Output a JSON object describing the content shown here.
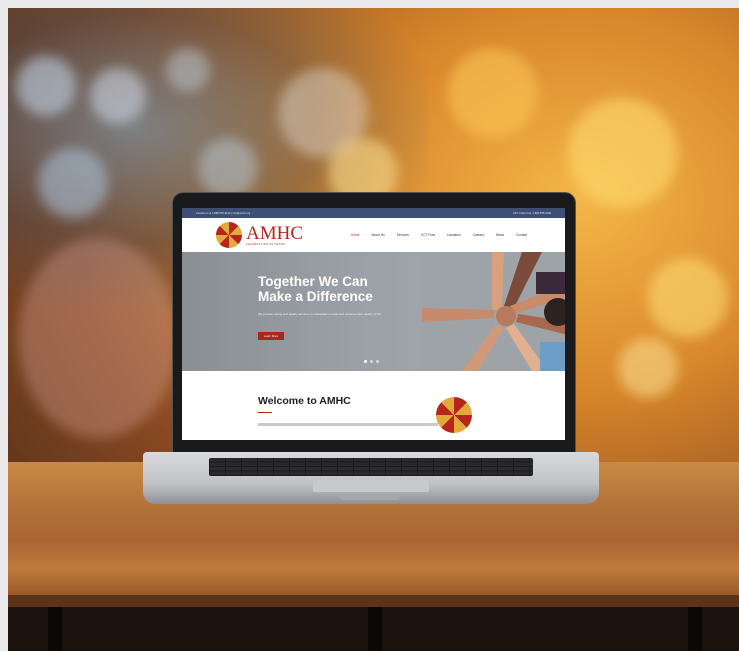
{
  "colors": {
    "brand_red": "#b7251c",
    "brand_gold": "#e3a93b",
    "topbar_navy": "#3d4f73"
  },
  "website": {
    "topbar": {
      "left_text": "Contact us at 1-888-555-0123 | info@amhc.org",
      "right_text": "24/7 Crisis Line: 1-800-555-0199"
    },
    "logo": {
      "title": "AMHC",
      "tagline": "CELEBRATING 50 YEARS"
    },
    "menu": [
      {
        "label": "Home",
        "active": true
      },
      {
        "label": "About Us",
        "active": false
      },
      {
        "label": "Services",
        "active": false
      },
      {
        "label": "CCT Flow",
        "active": false
      },
      {
        "label": "Locations",
        "active": false
      },
      {
        "label": "Careers",
        "active": false
      },
      {
        "label": "News",
        "active": false
      },
      {
        "label": "Contact",
        "active": false
      }
    ],
    "hero": {
      "title": "Together We Can\nMake a Difference",
      "subtitle": "We provide caring and quality services to individuals in need and enhance their quality of life.",
      "button_label": "Learn More"
    },
    "welcome": {
      "title": "Welcome to AMHC"
    }
  }
}
